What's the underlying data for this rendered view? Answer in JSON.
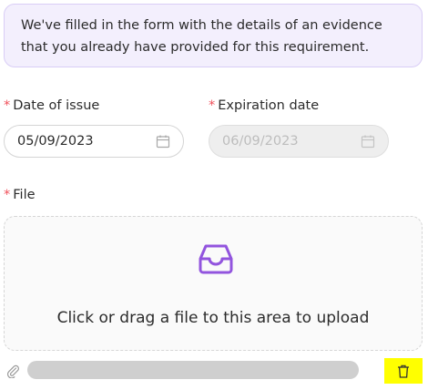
{
  "notice": {
    "line1": "We've filled in the form with the details of an evidence",
    "line2": "that you already have provided for this requirement."
  },
  "fields": {
    "date_of_issue": {
      "required_mark": "*",
      "label": "Date of issue",
      "value": "05/09/2023",
      "icon": "calendar-icon"
    },
    "expiration_date": {
      "required_mark": "*",
      "label": "Expiration date",
      "value": "06/09/2023",
      "disabled": true,
      "icon": "calendar-icon"
    }
  },
  "file": {
    "required_mark": "*",
    "label": "File",
    "upload_icon": "inbox-icon",
    "upload_hint": "Click or drag a file to this area to upload",
    "attachment_icon": "paperclip-icon",
    "delete_icon": "trash-icon",
    "progress_fraction": 1.0
  },
  "colors": {
    "accent": "#9254de",
    "required": "#f0505a",
    "notice_bg": "#f3effd",
    "highlight": "#ffff00"
  }
}
